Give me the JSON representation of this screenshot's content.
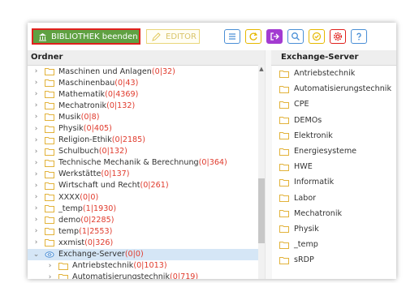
{
  "toolbar": {
    "beenden_label": "BIBLIOTHEK beenden",
    "editor_label": "EDITOR",
    "icons": [
      {
        "name": "list-icon",
        "color": "#4a8fd6"
      },
      {
        "name": "refresh-icon",
        "color": "#e6b800"
      },
      {
        "name": "export-icon",
        "color": "#a33bd1"
      },
      {
        "name": "search-icon",
        "color": "#4a8fd6"
      },
      {
        "name": "check-icon",
        "color": "#e6b800"
      },
      {
        "name": "settings-icon",
        "color": "#e0201c"
      },
      {
        "name": "help-icon",
        "color": "#4a8fd6"
      }
    ]
  },
  "left_pane": {
    "header": "Ordner",
    "items": [
      {
        "label": "Maschinen und Anlagen ",
        "count": "(0|32)"
      },
      {
        "label": "Maschinenbau ",
        "count": "(0|43)"
      },
      {
        "label": "Mathematik ",
        "count": "(0|4369)"
      },
      {
        "label": "Mechatronik ",
        "count": "(0|132)"
      },
      {
        "label": "Musik ",
        "count": "(0|8)"
      },
      {
        "label": "Physik ",
        "count": "(0|405)"
      },
      {
        "label": "Religion-Ethik ",
        "count": "(0|2185)"
      },
      {
        "label": "Schulbuch ",
        "count": "(0|132)"
      },
      {
        "label": "Technische Mechanik & Berechnung ",
        "count": "(0|364)"
      },
      {
        "label": "Werkstätte ",
        "count": "(0|137)"
      },
      {
        "label": "Wirtschaft und Recht ",
        "count": "(0|261)"
      },
      {
        "label": "XXXX ",
        "count": "(0|0)"
      },
      {
        "label": "_temp ",
        "count": "(1|1930)"
      },
      {
        "label": "demo ",
        "count": "(0|2285)"
      },
      {
        "label": "temp ",
        "count": "(1|2553)"
      },
      {
        "label": "xxmist ",
        "count": "(0|326)"
      },
      {
        "label": "Exchange-Server ",
        "count": "(0|0)"
      },
      {
        "label": "Antriebstechnik ",
        "count": "(0|1013)"
      },
      {
        "label": "Automatisierungstechnik ",
        "count": "(0|719)"
      }
    ]
  },
  "right_pane": {
    "header": "Exchange-Server",
    "items": [
      "Antriebstechnik",
      "Automatisierungstechnik",
      "CPE",
      "DEMOs",
      "Elektronik",
      "Energiesysteme",
      "HWE",
      "Informatik",
      "Labor",
      "Mechatronik",
      "Physik",
      "_temp",
      "sRDP"
    ]
  }
}
